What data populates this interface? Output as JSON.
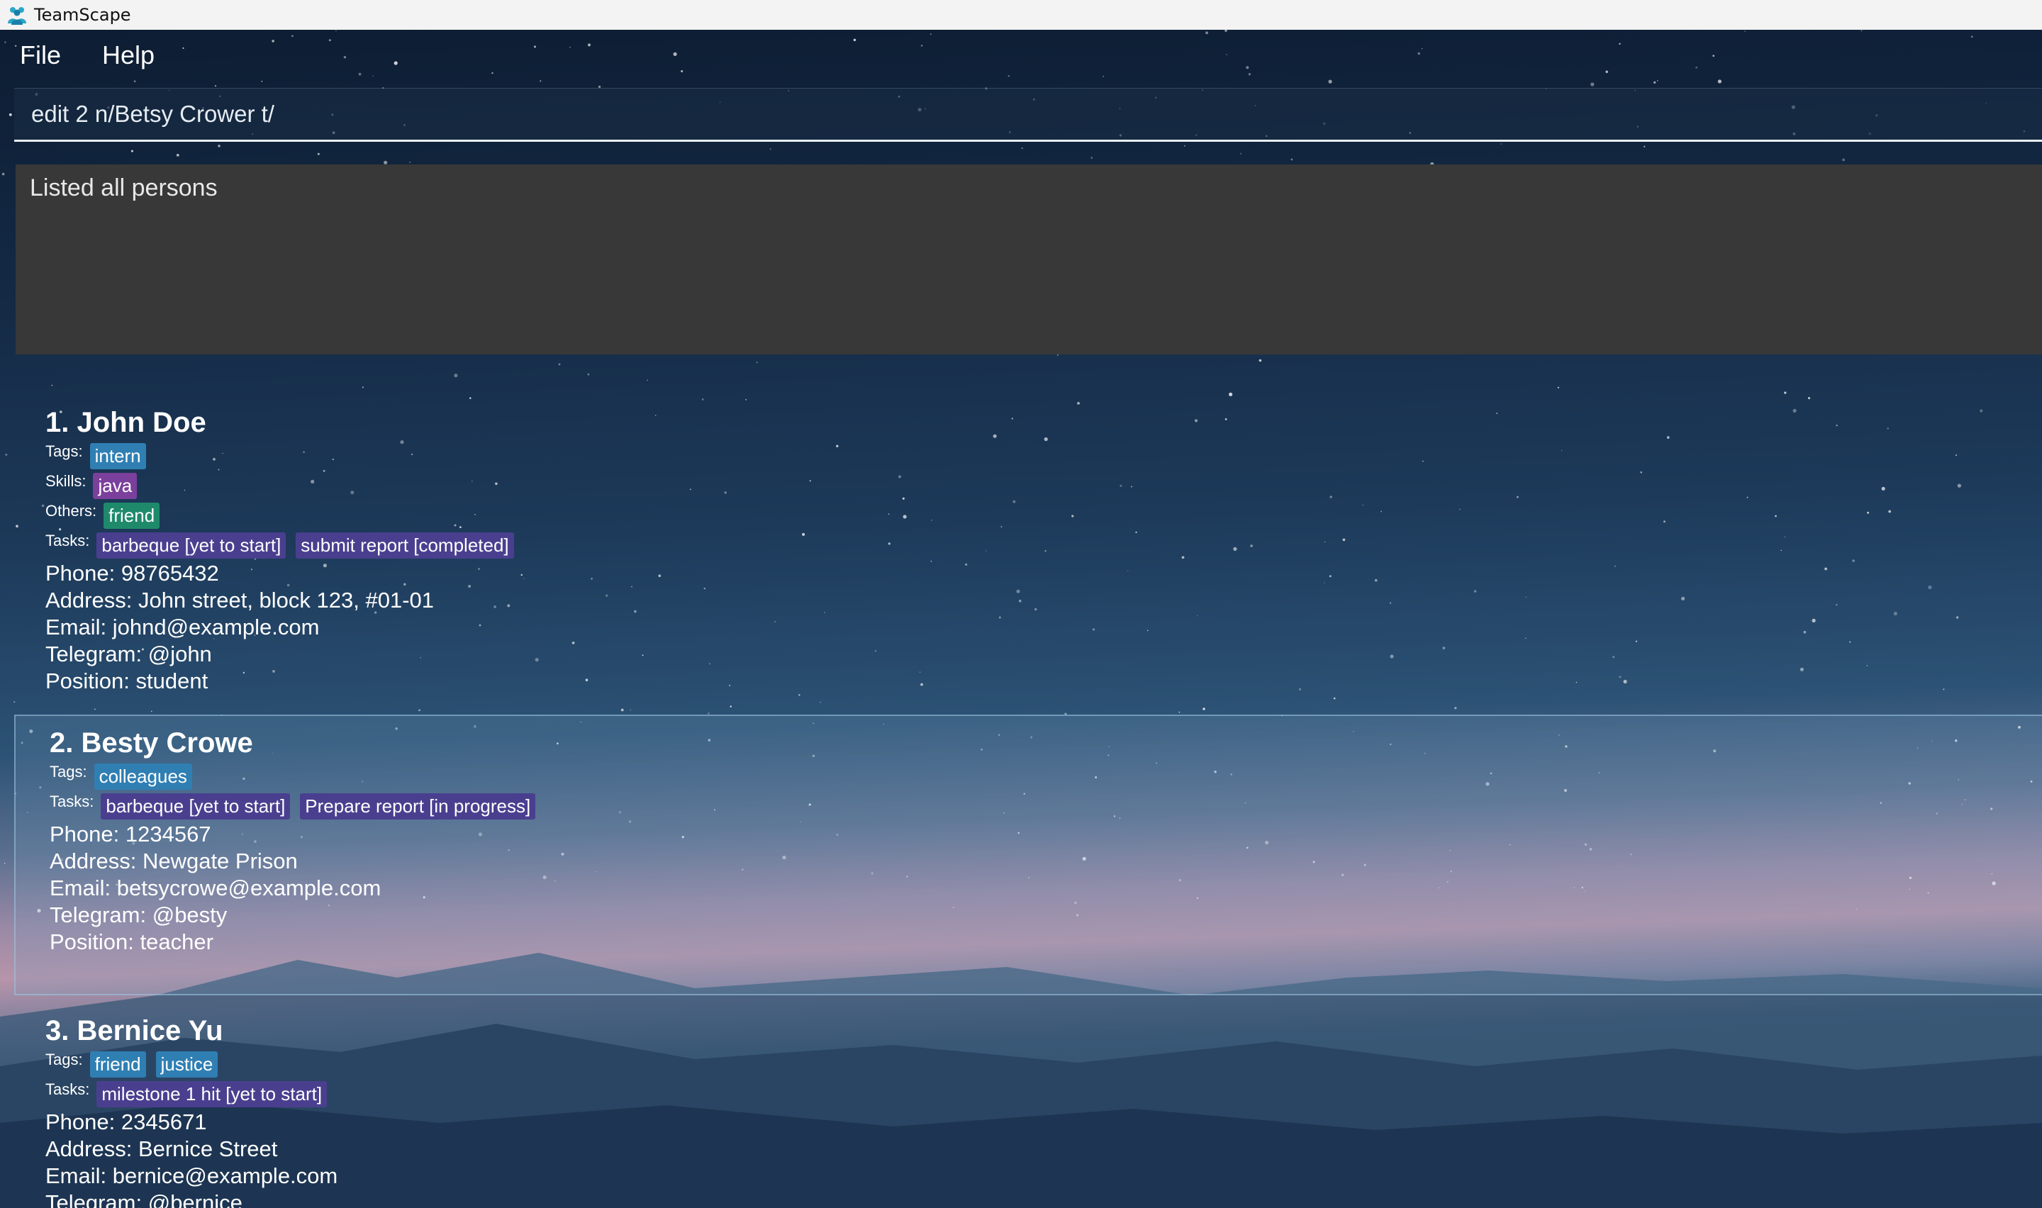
{
  "window": {
    "title": "TeamScape"
  },
  "menu": {
    "items": [
      "File",
      "Help"
    ]
  },
  "command": {
    "value": "edit 2 n/Betsy Crower t/"
  },
  "result": {
    "text": "Listed all persons"
  },
  "labels": {
    "tags": "Tags:",
    "skills": "Skills:",
    "others": "Others:",
    "tasks": "Tasks:"
  },
  "persons": [
    {
      "name": "1. John Doe",
      "tags": [
        "intern"
      ],
      "skills": [
        "java"
      ],
      "others": [
        "friend"
      ],
      "tasks": [
        "barbeque [yet to start]",
        "submit report [completed]"
      ],
      "phone": "Phone: 98765432",
      "address": "Address: John street, block 123, #01-01",
      "email": "Email: johnd@example.com",
      "telegram": "Telegram: @john",
      "position": "Position: student"
    },
    {
      "name": "2. Besty Crowe",
      "tags": [
        "colleagues"
      ],
      "tasks": [
        "barbeque [yet to start]",
        "Prepare report [in progress]"
      ],
      "phone": "Phone: 1234567",
      "address": "Address: Newgate Prison",
      "email": "Email: betsycrowe@example.com",
      "telegram": "Telegram: @besty",
      "position": "Position: teacher"
    },
    {
      "name": "3. Bernice Yu",
      "tags": [
        "friend",
        "justice"
      ],
      "tasks": [
        "milestone 1 hit [yet to start]"
      ],
      "phone": "Phone: 2345671",
      "address": "Address: Bernice Street",
      "email": "Email: bernice@example.com",
      "telegram": "Telegram: @bernice"
    }
  ],
  "colors": {
    "tag": "#2f7fb3",
    "skill": "#7b3f9c",
    "other": "#1f8a6b",
    "task": "#4a3f8f",
    "result_bg": "#383838"
  }
}
